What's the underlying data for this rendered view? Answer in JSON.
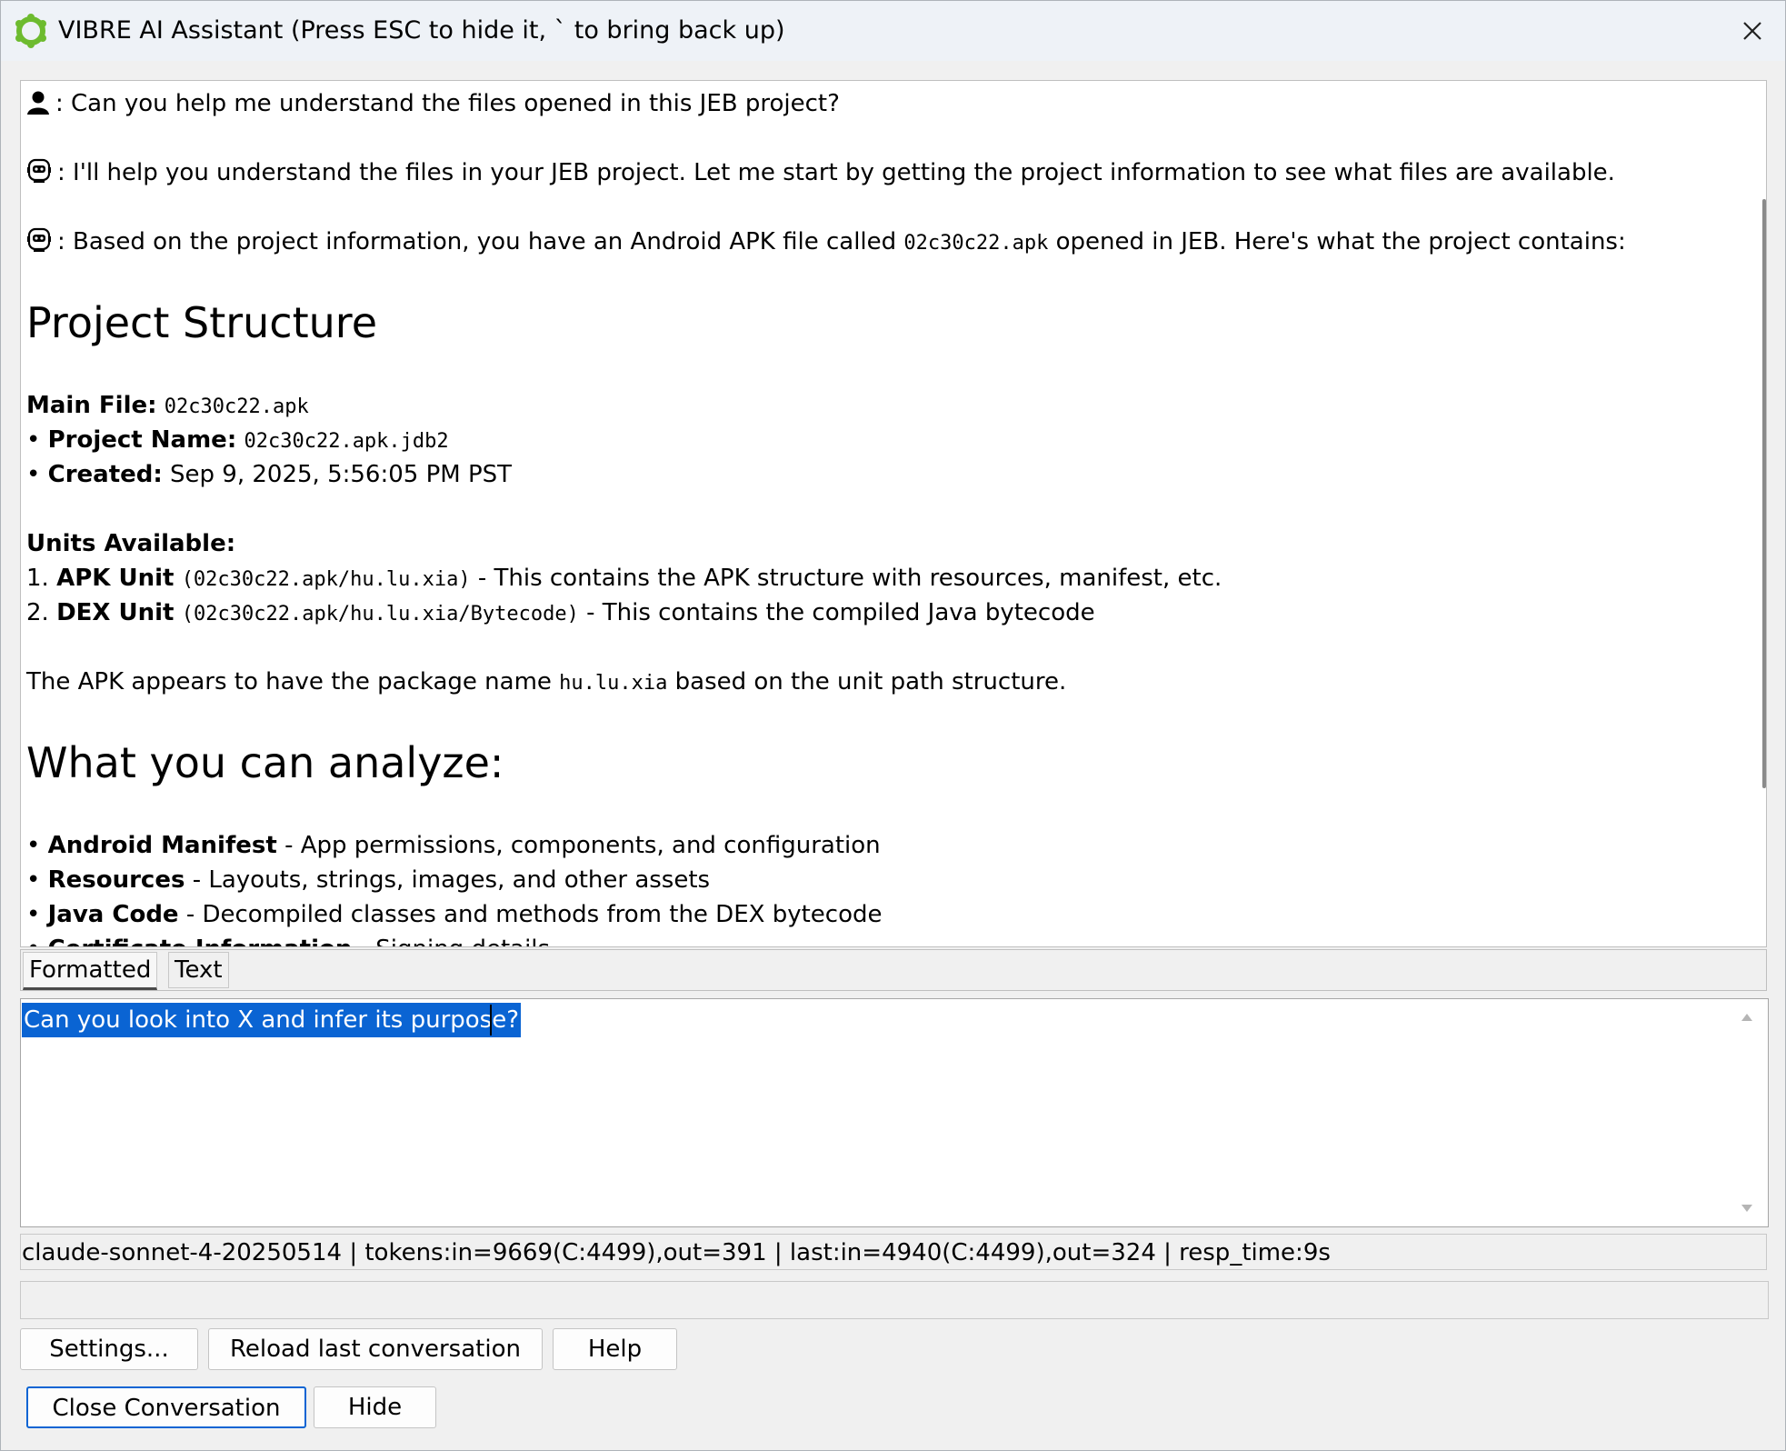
{
  "window": {
    "title": "VIBRE AI Assistant (Press ESC to hide it, ` to bring back up)",
    "accent_color": "#0a64d3",
    "logo_color": "#6dbb2f"
  },
  "chat": {
    "user_question": ": Can you help me understand the files opened in this JEB project?",
    "assistant_reply_1": ": I'll help you understand the files in your JEB project. Let me start by getting the project information to see what files are available.",
    "assistant_reply_2_pre": ": Based on the project information, you have an Android APK file called ",
    "assistant_reply_2_code": "02c30c22.apk",
    "assistant_reply_2_post": " opened in JEB. Here's what the project contains:",
    "heading_structure": "Project Structure",
    "main_file_label": "Main File:",
    "main_file_value": "02c30c22.apk",
    "bullet": "•",
    "project_name_label": "Project Name:",
    "project_name_value": "02c30c22.apk.jdb2",
    "created_label": "Created:",
    "created_value": "Sep 9, 2025, 5:56:05 PM PST",
    "units_label": "Units Available:",
    "unit1_num": "1.",
    "unit1_label": "APK Unit",
    "unit1_path": "(02c30c22.apk/hu.lu.xia)",
    "unit1_desc": " - This contains the APK structure with resources, manifest, etc.",
    "unit2_num": "2.",
    "unit2_label": "DEX Unit",
    "unit2_path": "(02c30c22.apk/hu.lu.xia/Bytecode)",
    "unit2_desc": " - This contains the compiled Java bytecode",
    "package_pre": "The APK appears to have the package name ",
    "package_code": "hu.lu.xia",
    "package_post": " based on the unit path structure.",
    "heading_analyze": "What you can analyze:",
    "analyze1_label": "Android Manifest",
    "analyze1_desc": " - App permissions, components, and configuration",
    "analyze2_label": "Resources",
    "analyze2_desc": " - Layouts, strings, images, and other assets",
    "analyze3_label": "Java Code",
    "analyze3_desc": " - Decompiled classes and methods from the DEX bytecode",
    "analyze4_label": "Certificate Information",
    "analyze4_desc": " - Signing details"
  },
  "tabs": {
    "formatted": "Formatted",
    "text": "Text"
  },
  "input": {
    "value": "Can you look into X and infer its purpose?"
  },
  "status": {
    "text": "claude-sonnet-4-20250514 | tokens:in=9669(C:4499),out=391 | last:in=4940(C:4499),out=324 | resp_time:9s"
  },
  "buttons": {
    "settings": "Settings...",
    "reload": "Reload last conversation",
    "help": "Help",
    "close_conversation": "Close Conversation",
    "hide": "Hide"
  }
}
